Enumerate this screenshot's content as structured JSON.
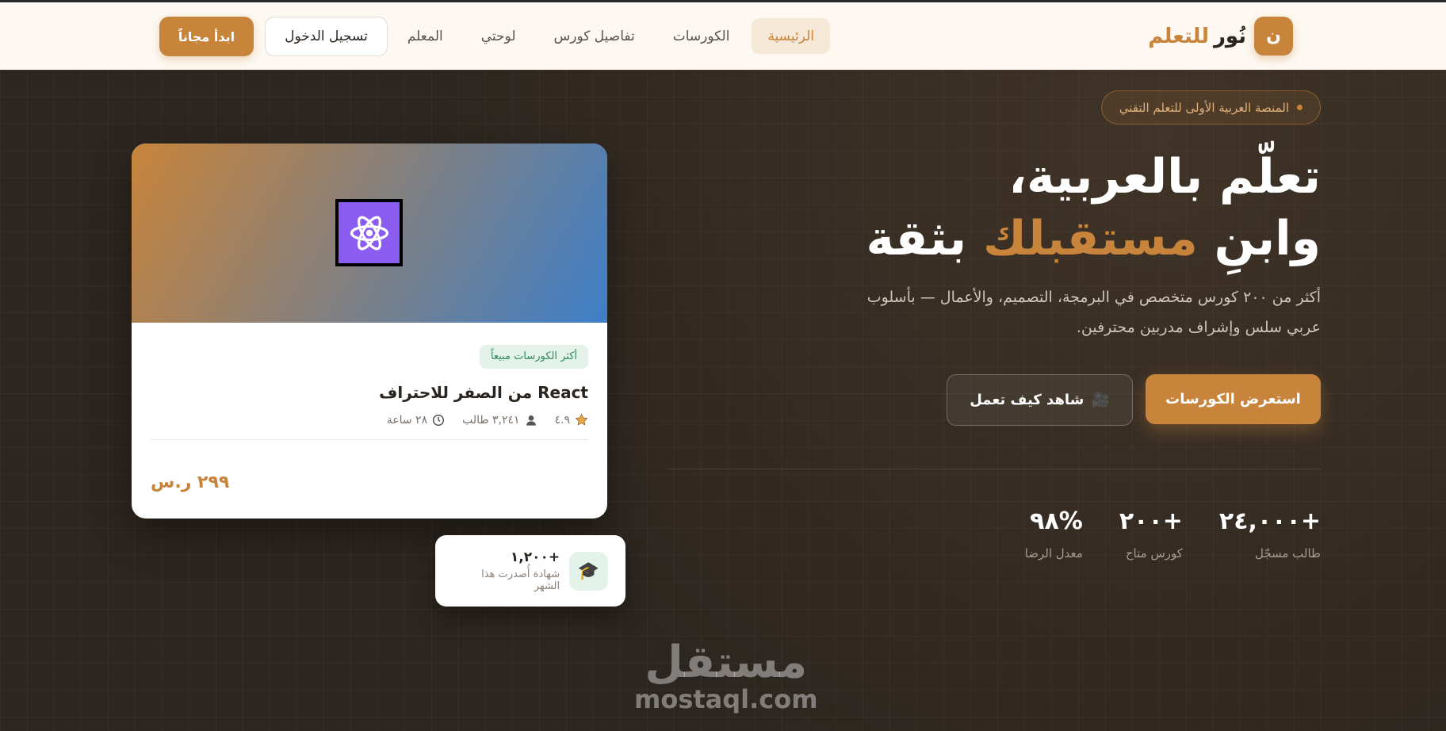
{
  "header": {
    "brand_mark": "ن",
    "brand_primary": "نُور",
    "brand_accent": "للتعلم",
    "nav": [
      {
        "label": "الرئيسية",
        "active": true
      },
      {
        "label": "الكورسات",
        "active": false
      },
      {
        "label": "تفاصيل كورس",
        "active": false
      },
      {
        "label": "لوحتي",
        "active": false
      },
      {
        "label": "المعلم",
        "active": false
      }
    ],
    "login_label": "تسجيل الدخول",
    "start_label": "ابدأ مجاناً"
  },
  "hero": {
    "badge": "المنصة العربية الأولى للتعلم التقني",
    "headline_line1": "تعلّم بالعربية،",
    "headline_line2_start": "وابنِ",
    "headline_line2_accent": "مستقبلك",
    "headline_line2_end": "بثقة",
    "subtitle": "أكثر من ٢٠٠ كورس متخصص في البرمجة، التصميم، والأعمال — بأسلوب عربي سلس وإشراف مدربين محترفين.",
    "primary_cta": "استعرض الكورسات",
    "secondary_cta": "شاهد كيف تعمل",
    "stats": [
      {
        "value": "+٢٤,٠٠٠",
        "label": "طالب مسجّل"
      },
      {
        "value": "+٢٠٠",
        "label": "كورس متاح"
      },
      {
        "value": "%٩٨",
        "label": "معدل الرضا"
      }
    ]
  },
  "course_card": {
    "tag": "أكثر الكورسات مبيعاً",
    "title": "React من الصفر للاحتراف",
    "rating": "٤.٩",
    "students": "٣,٢٤١ طالب",
    "duration": "٢٨ ساعة",
    "price": "٢٩٩ ر.س"
  },
  "certificate": {
    "count": "+١,٢٠٠",
    "label": "شهادة أُصدرت هذا الشهر"
  },
  "watermark": {
    "arabic": "مستقل",
    "latin": "mostaql.com"
  },
  "colors": {
    "accent": "#c8843a",
    "dark": "#2a241f",
    "header_bg": "#fdf8f1"
  }
}
